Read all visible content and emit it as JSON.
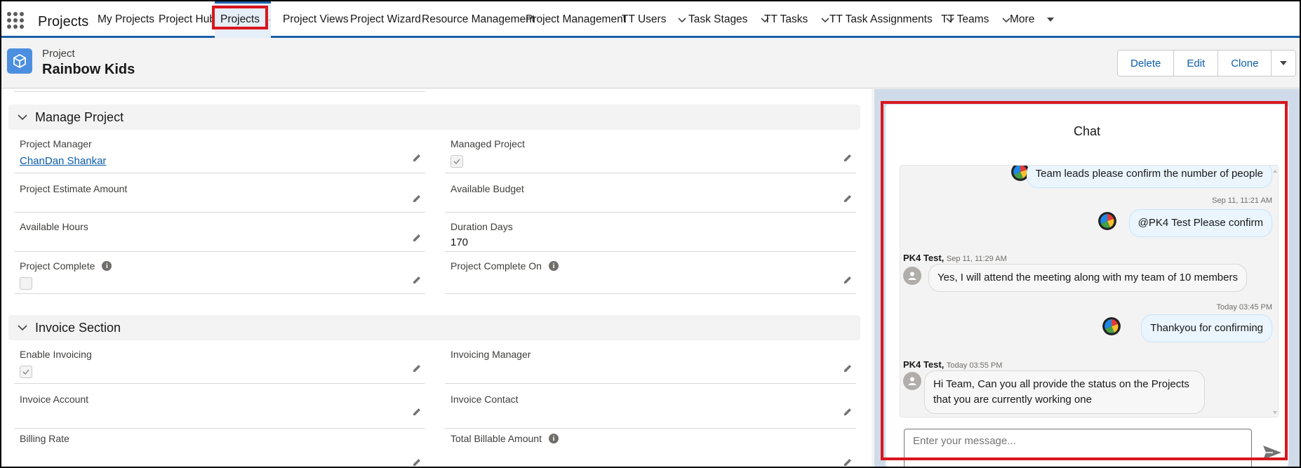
{
  "app": {
    "name": "Projects"
  },
  "nav": {
    "items": [
      {
        "label": "My Projects"
      },
      {
        "label": "Project Hub"
      },
      {
        "label": "Projects"
      },
      {
        "label": "Project Views"
      },
      {
        "label": "Project Wizard"
      },
      {
        "label": "Resource Management"
      },
      {
        "label": "Project Management"
      },
      {
        "label": "TT Users"
      },
      {
        "label": "Task Stages"
      },
      {
        "label": "TT Tasks"
      },
      {
        "label": "TT Task Assignments"
      },
      {
        "label": "TT Teams"
      },
      {
        "label": "More"
      }
    ]
  },
  "record": {
    "type": "Project",
    "title": "Rainbow Kids",
    "actions": {
      "delete": "Delete",
      "edit": "Edit",
      "clone": "Clone"
    }
  },
  "sections": {
    "manage": {
      "title": "Manage Project",
      "project_manager": {
        "label": "Project Manager",
        "value": "ChanDan Shankar"
      },
      "managed_project": {
        "label": "Managed Project",
        "checked": true
      },
      "estimate_amount": {
        "label": "Project Estimate Amount",
        "value": ""
      },
      "available_budget": {
        "label": "Available Budget",
        "value": ""
      },
      "available_hours": {
        "label": "Available Hours",
        "value": ""
      },
      "duration_days": {
        "label": "Duration Days",
        "value": "170"
      },
      "project_complete": {
        "label": "Project Complete",
        "checked": false
      },
      "project_complete_on": {
        "label": "Project Complete On",
        "value": ""
      }
    },
    "invoice": {
      "title": "Invoice Section",
      "enable_invoicing": {
        "label": "Enable Invoicing",
        "checked": true
      },
      "invoicing_manager": {
        "label": "Invoicing Manager",
        "value": ""
      },
      "invoice_account": {
        "label": "Invoice Account",
        "value": ""
      },
      "invoice_contact": {
        "label": "Invoice Contact",
        "value": ""
      },
      "billing_rate": {
        "label": "Billing Rate",
        "value": ""
      },
      "total_billable": {
        "label": "Total Billable Amount",
        "value": ""
      }
    }
  },
  "chat": {
    "title": "Chat",
    "messages": [
      {
        "text": "Team leads please confirm the number of people"
      },
      {
        "time": "Sep 11, 11:21 AM",
        "text": "@PK4 Test Please confirm"
      },
      {
        "sender": "PK4 Test,",
        "time": "Sep 11, 11:29 AM",
        "text": "Yes, I will attend the meeting along with my team of 10 members"
      },
      {
        "time": "Today 03:45 PM",
        "text": "Thankyou for confirming"
      },
      {
        "sender": "PK4 Test,",
        "time": "Today 03:55 PM",
        "text": "Hi Team, Can you all provide the status on the Projects that you are currently working one"
      }
    ],
    "input_placeholder": "Enter your message..."
  },
  "colors": {
    "brand_blue": "#1b5fa6",
    "link_blue": "#0b5cab",
    "highlight_red": "#d8161e",
    "record_icon": "#4c8fe0",
    "chat_background": "#cfdbe8"
  }
}
